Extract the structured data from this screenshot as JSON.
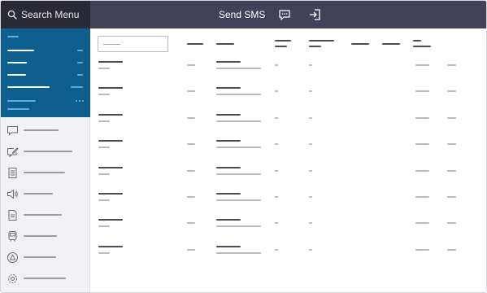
{
  "search": {
    "label": "Search Menu"
  },
  "header": {
    "title": "Send SMS"
  },
  "icons": {
    "search": "search-icon",
    "chat": "chat-icon",
    "sign_in": "sign-in-icon",
    "sidebar": [
      "chat-bubble-icon",
      "edit-message-icon",
      "document-icon",
      "megaphone-icon",
      "file-icon",
      "train-icon",
      "warning-icon",
      "gear-icon"
    ]
  },
  "colors": {
    "topbar": "#41425a",
    "search_bg": "#2a2a35",
    "sidebar_active": "#0e5e8e",
    "accent": "#52b0e6",
    "sidebar_bg": "#f1f1f3"
  },
  "table": {
    "columns": 8,
    "rows": 8
  }
}
